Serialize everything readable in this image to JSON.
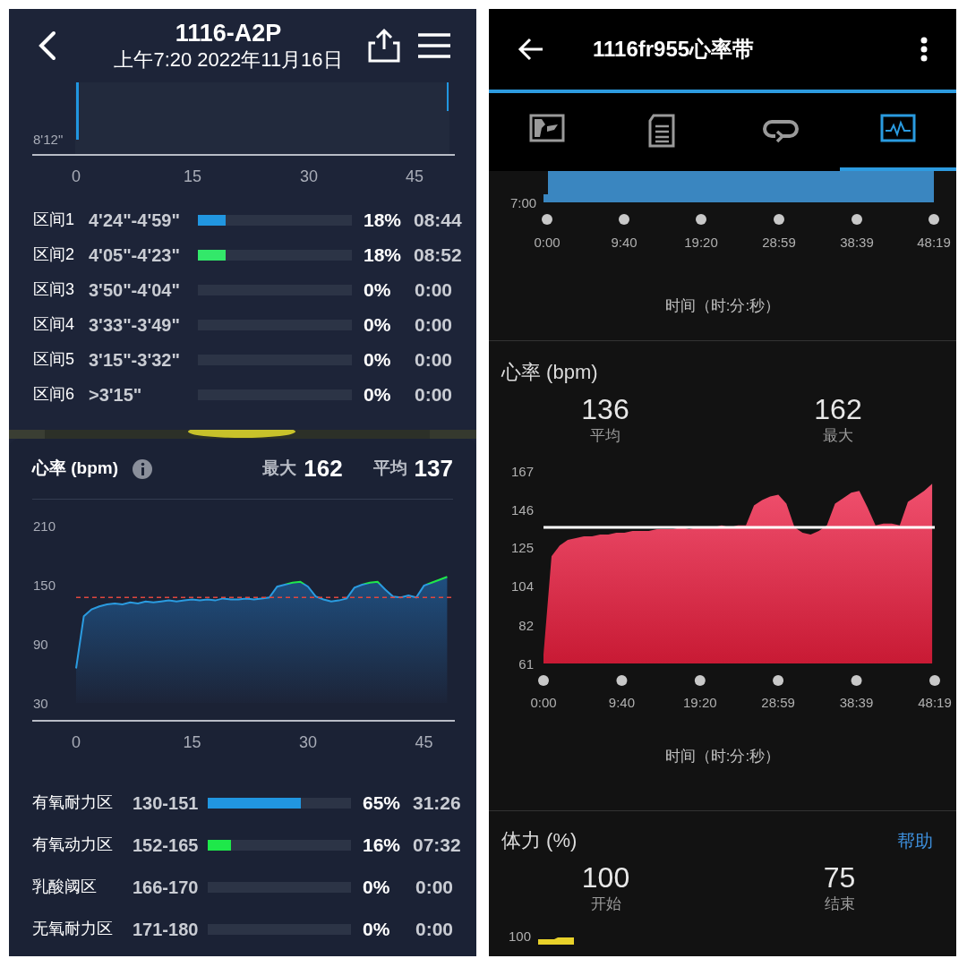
{
  "left": {
    "header": {
      "title": "1116-A2P",
      "subtitle": "上午7:20 2022年11月16日"
    },
    "pace_chart": {
      "y_tick": "8'12\"",
      "x_ticks": [
        "0",
        "15",
        "30",
        "45"
      ]
    },
    "pace_zones": [
      {
        "label": "区间1",
        "range": "4'24\"-4'59\"",
        "level": 0.18,
        "color": "#2196e0",
        "percent": "18%",
        "time": "08:44"
      },
      {
        "label": "区间2",
        "range": "4'05\"-4'23\"",
        "level": 0.18,
        "color": "#33e86a",
        "percent": "18%",
        "time": "08:52"
      },
      {
        "label": "区间3",
        "range": "3'50\"-4'04\"",
        "percent": "0%",
        "time": "0:00"
      },
      {
        "label": "区间4",
        "range": "3'33\"-3'49\"",
        "percent": "0%",
        "time": "0:00"
      },
      {
        "label": "区间5",
        "range": "3'15\"-3'32\"",
        "percent": "0%",
        "time": "0:00"
      },
      {
        "label": "区间6",
        "range": ">3'15\"",
        "percent": "0%",
        "time": "0:00"
      }
    ],
    "heart_rate": {
      "title": "心率 (bpm)",
      "max_label": "最大",
      "max_value": "162",
      "avg_label": "平均",
      "avg_value": "137",
      "chart_data": {
        "type": "area",
        "ylim": [
          30,
          210
        ],
        "yticks": [
          30,
          90,
          150,
          210
        ],
        "xlim": [
          0,
          48.3
        ],
        "xticks": [
          0,
          15,
          30,
          45
        ],
        "x": [
          0,
          1,
          2,
          3,
          4,
          5,
          6,
          7,
          8,
          9,
          10,
          11,
          12,
          13,
          14,
          15,
          16,
          17,
          18,
          19,
          20,
          21,
          22,
          23,
          24,
          25,
          26,
          27,
          28,
          29,
          30,
          31,
          32,
          33,
          34,
          35,
          36,
          37,
          38,
          39,
          40,
          41,
          42,
          43,
          44,
          45,
          46,
          47,
          48
        ],
        "series": [
          {
            "color": "#2a9be0",
            "values": [
              65,
              118,
              125,
              128,
              130,
              131,
              130,
              132,
              131,
              133,
              132,
              133,
              134,
              133,
              134,
              135,
              134,
              135,
              134,
              136,
              135,
              135,
              136,
              135,
              136,
              137,
              148,
              150,
              152,
              153,
              148,
              138,
              135,
              133,
              134,
              136,
              147,
              150,
              152,
              153,
              145,
              138,
              137,
              139,
              137,
              149,
              152,
              155,
              158
            ]
          }
        ],
        "ref_lines": [
          {
            "axis": "y",
            "value": 137
          }
        ]
      },
      "zones": [
        {
          "label": "有氧耐力区",
          "range": "130-151",
          "level": 0.65,
          "color": "#2196e0",
          "percent": "65%",
          "time": "31:26"
        },
        {
          "label": "有氧动力区",
          "range": "152-165",
          "level": 0.16,
          "color": "#1ee84a",
          "percent": "16%",
          "time": "07:32"
        },
        {
          "label": "乳酸阈区",
          "range": "166-170",
          "percent": "0%",
          "time": "0:00"
        },
        {
          "label": "无氧耐力区",
          "range": "171-180",
          "percent": "0%",
          "time": "0:00"
        }
      ]
    }
  },
  "right": {
    "header": {
      "title": "1116fr955心率带"
    },
    "tabs": [
      {
        "kind": "map",
        "selected": false
      },
      {
        "kind": "list",
        "selected": false
      },
      {
        "kind": "loop",
        "selected": false
      },
      {
        "kind": "chart",
        "selected": true
      }
    ],
    "pace_chart": {
      "y_tick": "7:00",
      "x_ticks": [
        "0:00",
        "9:40",
        "19:20",
        "28:59",
        "38:39",
        "48:19"
      ],
      "axis_title": "时间（时:分:秒）"
    },
    "heart_rate": {
      "title": "心率 (bpm)",
      "stats": [
        {
          "value": "136",
          "label": "平均"
        },
        {
          "value": "162",
          "label": "最大"
        }
      ],
      "chart_data": {
        "type": "area",
        "ylim": [
          61,
          167
        ],
        "yticks": [
          61,
          82,
          104,
          125,
          146,
          167
        ],
        "xlim": [
          0,
          48.32
        ],
        "xticks": [
          {
            "value": 0,
            "label": "0:00"
          },
          {
            "value": 9.67,
            "label": "9:40"
          },
          {
            "value": 19.33,
            "label": "19:20"
          },
          {
            "value": 28.98,
            "label": "28:59"
          },
          {
            "value": 38.65,
            "label": "38:39"
          },
          {
            "value": 48.32,
            "label": "48:19"
          }
        ],
        "x": [
          0,
          1,
          2,
          3,
          4,
          5,
          6,
          7,
          8,
          9,
          10,
          11,
          12,
          13,
          14,
          15,
          16,
          17,
          18,
          19,
          20,
          21,
          22,
          23,
          24,
          25,
          26,
          27,
          28,
          29,
          30,
          31,
          32,
          33,
          34,
          35,
          36,
          37,
          38,
          39,
          40,
          41,
          42,
          43,
          44,
          45,
          46,
          47,
          48
        ],
        "series": [
          {
            "color": "#c81a34",
            "values": [
              66,
              120,
              126,
              129,
              130,
              131,
              131,
              132,
              132,
              133,
              133,
              134,
              134,
              134,
              135,
              135,
              135,
              136,
              135,
              136,
              136,
              136,
              137,
              136,
              137,
              137,
              148,
              151,
              153,
              154,
              149,
              136,
              133,
              132,
              134,
              137,
              149,
              152,
              155,
              156,
              147,
              137,
              138,
              138,
              137,
              150,
              153,
              156,
              160
            ]
          }
        ],
        "ref_lines": [
          {
            "axis": "y",
            "value": 136
          }
        ]
      },
      "axis_title": "时间（时:分:秒）"
    },
    "stamina": {
      "title": "体力 (%)",
      "help": "帮助",
      "stats": [
        {
          "value": "100",
          "label": "开始"
        },
        {
          "value": "75",
          "label": "结束"
        }
      ],
      "y_tick": "100"
    }
  }
}
